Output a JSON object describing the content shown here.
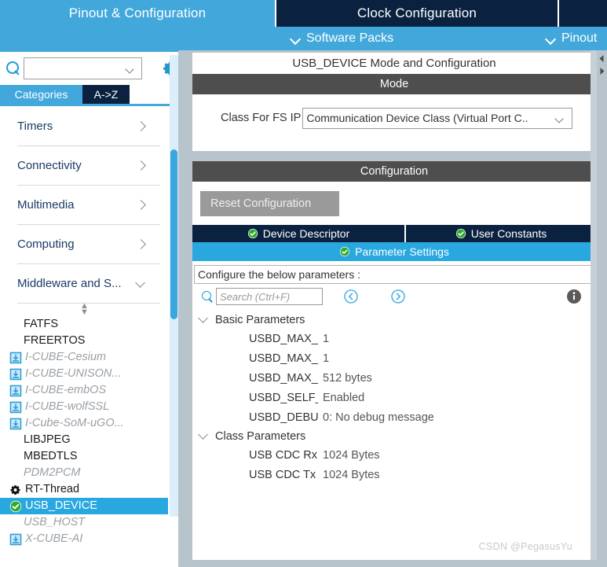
{
  "tabs": {
    "pinout_configuration": "Pinout & Configuration",
    "clock_configuration": "Clock Configuration",
    "third_tab": ""
  },
  "subbar": {
    "software_packs": "Software Packs",
    "pinout": "Pinout"
  },
  "sidebar": {
    "search": {
      "value": "",
      "placeholder": ""
    },
    "gear_icon": "gear-icon",
    "view_tabs": [
      {
        "label": "Categories",
        "selected": true
      },
      {
        "label": "A->Z",
        "selected": false
      }
    ],
    "categories": [
      {
        "label": "Timers",
        "expanded": false
      },
      {
        "label": "Connectivity",
        "expanded": false
      },
      {
        "label": "Multimedia",
        "expanded": false
      },
      {
        "label": "Computing",
        "expanded": false
      },
      {
        "label": "Middleware and S...",
        "expanded": true
      }
    ],
    "middleware_items": [
      {
        "label": "FATFS",
        "state": "plain",
        "icon": "none"
      },
      {
        "label": "FREERTOS",
        "state": "plain",
        "icon": "none"
      },
      {
        "label": "I-CUBE-Cesium",
        "state": "dim",
        "icon": "download-pack-icon"
      },
      {
        "label": "I-CUBE-UNISON...",
        "state": "dim",
        "icon": "download-pack-icon"
      },
      {
        "label": "I-CUBE-embOS",
        "state": "dim",
        "icon": "download-pack-icon"
      },
      {
        "label": "I-CUBE-wolfSSL",
        "state": "dim",
        "icon": "download-pack-icon"
      },
      {
        "label": "I-Cube-SoM-uGO...",
        "state": "dim",
        "icon": "download-pack-icon"
      },
      {
        "label": "LIBJPEG",
        "state": "plain",
        "icon": "none"
      },
      {
        "label": "MBEDTLS",
        "state": "plain",
        "icon": "none"
      },
      {
        "label": "PDM2PCM",
        "state": "dim",
        "icon": "none"
      },
      {
        "label": "RT-Thread",
        "state": "plain",
        "icon": "gear-icon"
      },
      {
        "label": "USB_DEVICE",
        "state": "selected",
        "icon": "check-ok-icon"
      },
      {
        "label": "USB_HOST",
        "state": "dim",
        "icon": "none"
      },
      {
        "label": "X-CUBE-AI",
        "state": "dim",
        "icon": "download-pack-icon"
      }
    ]
  },
  "main": {
    "panel_title": "USB_DEVICE Mode and Configuration",
    "mode_section": {
      "header": "Mode",
      "field_label": "Class For FS IP",
      "field_value": "Communication Device Class (Virtual Port C.."
    },
    "configuration_section": {
      "header": "Configuration",
      "reset_button": "Reset Configuration",
      "tabs": [
        {
          "label": "Device Descriptor",
          "selected": false,
          "status_icon": "check-ok-icon"
        },
        {
          "label": "User Constants",
          "selected": false,
          "status_icon": "check-ok-icon"
        },
        {
          "label": "Parameter Settings",
          "selected": true,
          "status_icon": "check-ok-icon"
        }
      ],
      "hint": "Configure the below parameters :",
      "search": {
        "value": "",
        "placeholder": "Search (Ctrl+F)"
      },
      "nav_prev_icon": "circle-chevron-left-icon",
      "nav_next_icon": "circle-chevron-right-icon",
      "info_icon": "info-icon",
      "groups": [
        {
          "name": "Basic Parameters",
          "expanded": true,
          "params": [
            {
              "name": "USBD_MAX_NUM_INTE...",
              "value": "1"
            },
            {
              "name": "USBD_MAX_NUM_CON...",
              "value": "1"
            },
            {
              "name": "USBD_MAX_STR_DES...",
              "value": "512 bytes"
            },
            {
              "name": "USBD_SELF_POWERE...",
              "value": "Enabled"
            },
            {
              "name": "USBD_DEBUG_LEVEL ...",
              "value": "0: No debug message"
            }
          ]
        },
        {
          "name": "Class Parameters",
          "expanded": true,
          "params": [
            {
              "name": "USB CDC Rx Buffer Size",
              "value": "1024 Bytes"
            },
            {
              "name": "USB CDC Tx Buffer Size",
              "value": "1024 Bytes"
            }
          ]
        }
      ]
    }
  },
  "watermark": "CSDN @PegasusYu",
  "colors": {
    "accent_blue": "#42a8dc",
    "dark_navy": "#0a2240",
    "section_gray": "#4e4e4e",
    "selected_blue": "#29a8e0",
    "panel_bg": "#b8c4cc",
    "ok_green": "#3aa03a"
  }
}
